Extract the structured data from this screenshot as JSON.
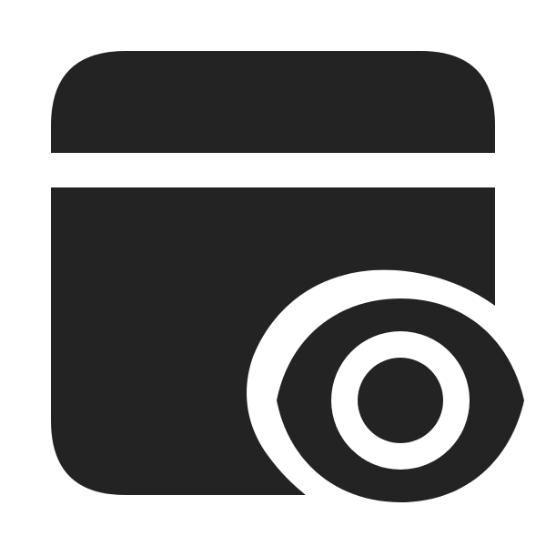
{
  "icon": {
    "name": "window-eye-icon",
    "parts": [
      "window-header-icon",
      "window-body-icon",
      "eye-icon",
      "eye-pupil-icon"
    ]
  },
  "colors": {
    "background": "#ffffff",
    "foreground": "#232323"
  }
}
